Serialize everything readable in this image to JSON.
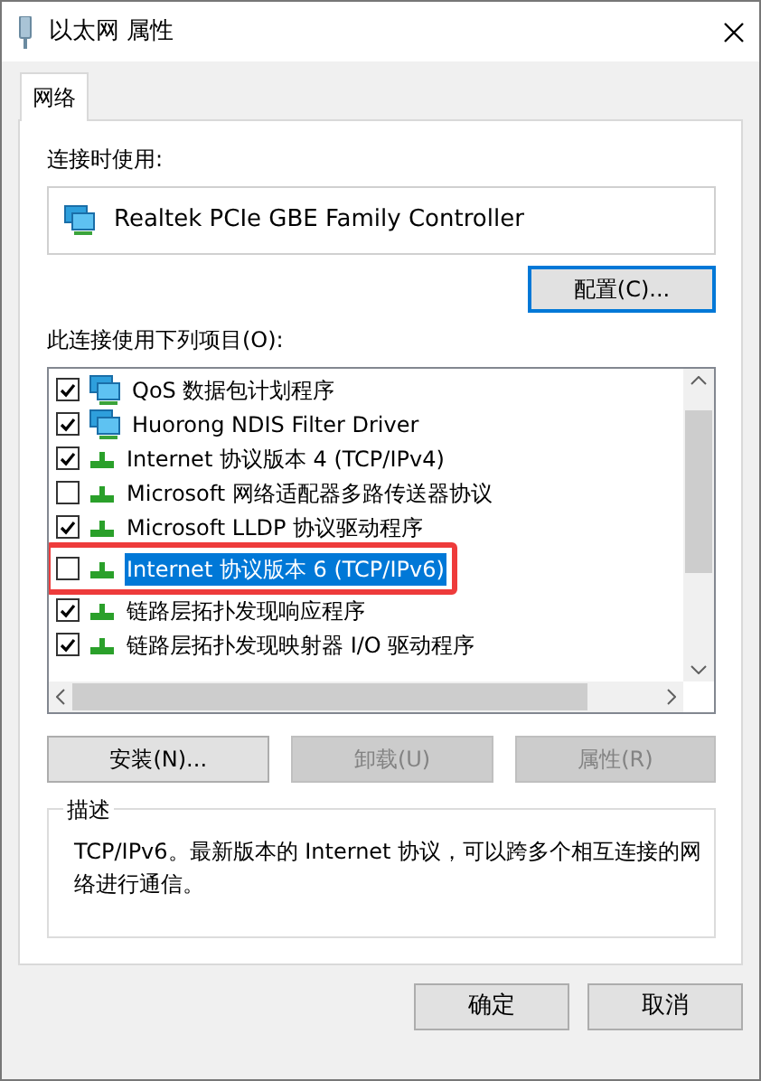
{
  "window": {
    "title": "以太网 属性"
  },
  "tabs": [
    {
      "label": "网络",
      "selected": true
    }
  ],
  "connect_using": {
    "label": "连接时使用:",
    "adapter": "Realtek PCIe GBE Family Controller"
  },
  "configure_button": {
    "label": "配置(C)...",
    "focused": true
  },
  "items_label": "此连接使用下列项目(O):",
  "items": [
    {
      "kind": "service",
      "label": "QoS 数据包计划程序",
      "checked": true,
      "selected": false,
      "annotated": false
    },
    {
      "kind": "service",
      "label": "Huorong NDIS Filter Driver",
      "checked": true,
      "selected": false,
      "annotated": false
    },
    {
      "kind": "protocol",
      "label": "Internet 协议版本 4 (TCP/IPv4)",
      "checked": true,
      "selected": false,
      "annotated": false
    },
    {
      "kind": "protocol",
      "label": "Microsoft 网络适配器多路传送器协议",
      "checked": false,
      "selected": false,
      "annotated": false
    },
    {
      "kind": "protocol",
      "label": "Microsoft LLDP 协议驱动程序",
      "checked": true,
      "selected": false,
      "annotated": false
    },
    {
      "kind": "protocol",
      "label": "Internet 协议版本 6 (TCP/IPv6)",
      "checked": false,
      "selected": true,
      "annotated": true
    },
    {
      "kind": "protocol",
      "label": "链路层拓扑发现响应程序",
      "checked": true,
      "selected": false,
      "annotated": false
    },
    {
      "kind": "protocol",
      "label": "链路层拓扑发现映射器 I/O 驱动程序",
      "checked": true,
      "selected": false,
      "annotated": false
    }
  ],
  "item_buttons": [
    {
      "label": "安装(N)...",
      "disabled": false
    },
    {
      "label": "卸载(U)",
      "disabled": true
    },
    {
      "label": "属性(R)",
      "disabled": true
    }
  ],
  "description": {
    "title": "描述",
    "text": "TCP/IPv6。最新版本的 Internet 协议，可以跨多个相互连接的网络进行通信。"
  },
  "footer_buttons": [
    {
      "label": "确定"
    },
    {
      "label": "取消"
    }
  ]
}
